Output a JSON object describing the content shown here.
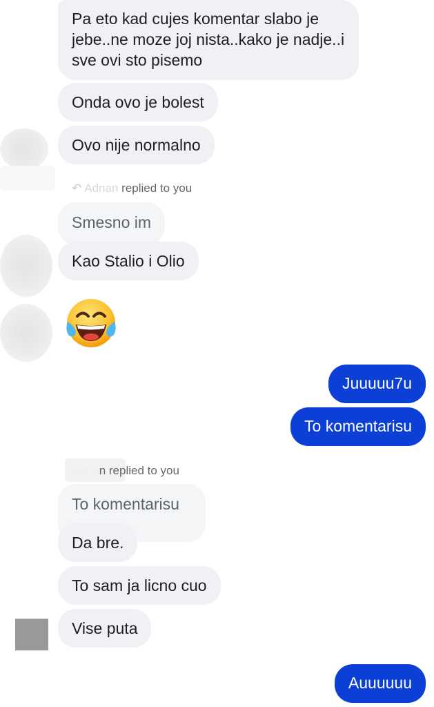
{
  "messages": {
    "m1": "Pa eto kad cujes komentar slabo je jebe..ne moze joj nista..kako je nadje..i sve ovi sto pisemo",
    "m2": "Onda ovo je bolest",
    "m3": "Ovo nije normalno",
    "reply1": {
      "name": "Adnan",
      "suffix": "replied to you",
      "quote": "Smesno im"
    },
    "m4": "Kao Stalio i Olio",
    "emoji": "laughing-with-tears-emoji",
    "out1": "Juuuuu7u",
    "out2": "To komentarisu",
    "reply2": {
      "name": "Adna",
      "suffix": "n replied to you",
      "quote": "To komentarisu"
    },
    "m5": "Da bre.",
    "m6": "To sam ja licno cuo",
    "m7": "Vise puta",
    "out3": "Auuuuuu"
  },
  "colors": {
    "outgoing_bubble": "#0b3fd6",
    "incoming_bubble": "#f0f1f4",
    "quote_text": "#5f6368"
  }
}
